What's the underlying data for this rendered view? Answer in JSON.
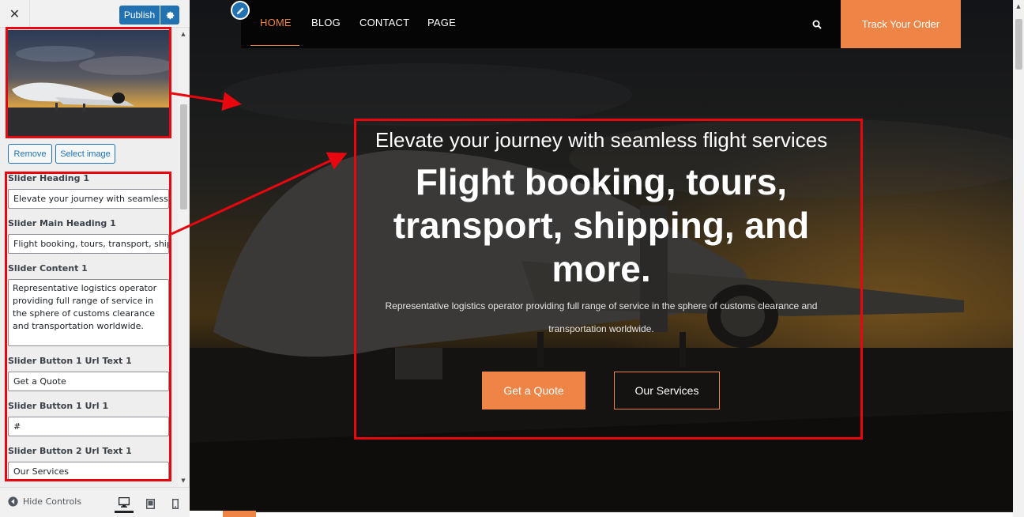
{
  "customizer": {
    "close_label": "✕",
    "publish_label": "Publish",
    "remove_label": "Remove",
    "select_image_label": "Select image",
    "fields": {
      "slider_heading_label": "Slider Heading 1",
      "slider_heading_value": "Elevate your journey with seamless fli",
      "slider_main_heading_label": "Slider Main Heading 1",
      "slider_main_heading_value": "Flight booking, tours, transport, shipp",
      "slider_content_label": "Slider Content 1",
      "slider_content_value": "Representative logistics operator providing full range of service in the sphere of customs clearance and transportation worldwide.",
      "button1_text_label": "Slider Button 1 Url Text 1",
      "button1_text_value": "Get a Quote",
      "button1_url_label": "Slider Button 1 Url 1",
      "button1_url_value": "#",
      "button2_text_label": "Slider Button 2 Url Text 1",
      "button2_text_value": "Our Services"
    },
    "hide_controls_label": "Hide Controls"
  },
  "site": {
    "nav": {
      "home": "HOME",
      "blog": "BLOG",
      "contact": "CONTACT",
      "page": "PAGE"
    },
    "track_order_label": "Track Your Order",
    "hero": {
      "subheading": "Elevate your journey with seamless flight services",
      "heading": "Flight booking, tours, transport, shipping, and more.",
      "content": "Representative logistics operator providing full range of service in the sphere of customs clearance and transportation worldwide.",
      "button_quote": "Get a Quote",
      "button_services": "Our Services"
    }
  },
  "icons": {
    "close": "close-icon",
    "settings": "gear-icon",
    "edit": "pencil-icon",
    "search": "search-icon",
    "hide_controls": "arrow-left-circle-icon",
    "desktop": "desktop-icon",
    "tablet": "tablet-icon",
    "mobile": "mobile-icon"
  },
  "colors": {
    "accent": "#ee8446",
    "wp_blue": "#2271b1",
    "annotation_red": "#e8060f"
  }
}
